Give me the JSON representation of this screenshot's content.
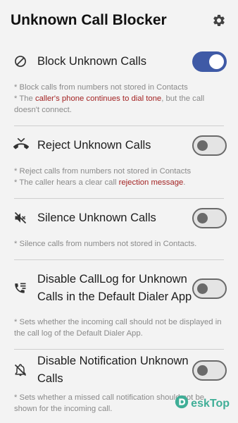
{
  "app": {
    "title": "Unknown Call Blocker",
    "settings_icon": "gear-icon"
  },
  "settings": [
    {
      "label": "Block Unknown Calls",
      "icon": "block-icon",
      "enabled": true,
      "note1": "* Block calls from numbers not stored in Contacts",
      "note2_pre": "* The ",
      "note2_hl": "caller's phone continues to dial tone",
      "note2_post": ", but the call doesn't connect."
    },
    {
      "label": "Reject Unknown Calls",
      "icon": "call-end-icon",
      "enabled": false,
      "note1": "* Reject calls from numbers not stored in Contacts",
      "note2_pre": "* The caller hears a clear call ",
      "note2_hl": "rejection message",
      "note2_post": "."
    },
    {
      "label": "Silence Unknown Calls",
      "icon": "volume-off-icon",
      "enabled": false,
      "note1": "* Silence calls from numbers not stored in Contacts."
    },
    {
      "label": "Disable CallLog for Unknown Calls in the Default Dialer App",
      "icon": "call-log-icon",
      "enabled": false,
      "note1": "* Sets whether the incoming call should not be displayed in the call log of the Default Dialer App."
    },
    {
      "label": "Disable Notification Unknown Calls",
      "icon": "notifications-off-icon",
      "enabled": false,
      "note1": "* Sets whether a missed call notification should not be shown for the incoming call."
    }
  ],
  "watermark": {
    "text": "eskTop",
    "icon": "desktop-logo-icon"
  },
  "colors": {
    "accent": "#3f5aa6",
    "highlight": "#a32323",
    "note": "#8a8a8a"
  }
}
